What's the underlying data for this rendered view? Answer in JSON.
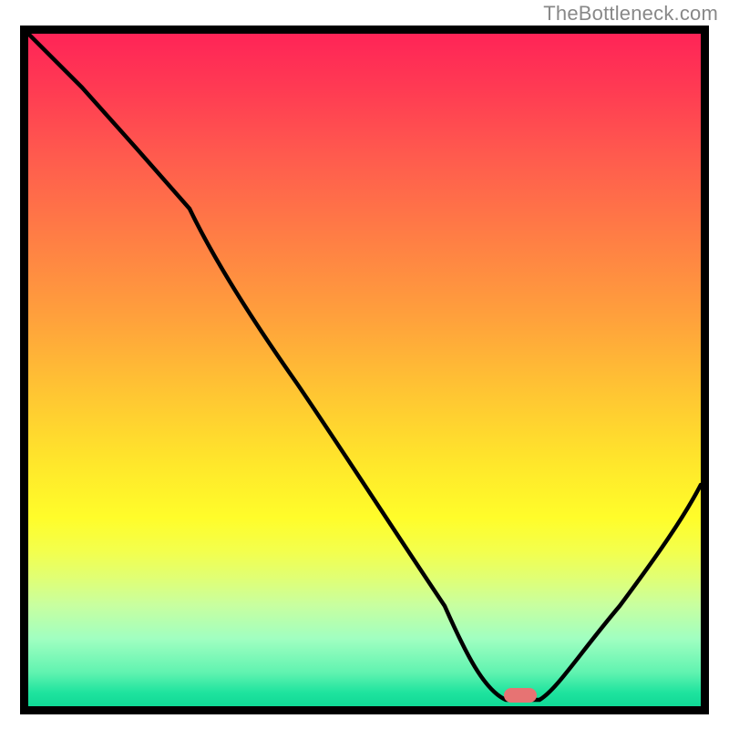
{
  "watermark": "TheBottleneck.com",
  "colors": {
    "frame_border": "#000000",
    "curve": "#000000",
    "marker": "#e77373",
    "gradient_top": "#ff2457",
    "gradient_mid": "#ffe72b",
    "gradient_bottom": "#10d996",
    "watermark_text": "#888888"
  },
  "chart_data": {
    "type": "line",
    "title": "",
    "xlabel": "",
    "ylabel": "",
    "xlim": [
      0,
      100
    ],
    "ylim": [
      0,
      100
    ],
    "annotations": [
      "TheBottleneck.com"
    ],
    "note": "x in 0–100 relative horizontal position, y in 0–100 where 0=bottom 100=top; estimated from image",
    "series": [
      {
        "name": "bottleneck-curve",
        "x": [
          0,
          8,
          16,
          24,
          32,
          40,
          48,
          56,
          62,
          67,
          71,
          76,
          82,
          88,
          94,
          100
        ],
        "y": [
          100,
          92,
          83,
          74,
          65,
          52,
          40,
          27,
          15,
          6,
          1,
          1,
          6,
          14,
          23,
          33
        ]
      }
    ],
    "marker": {
      "x": 73,
      "y": 1,
      "shape": "pill"
    }
  }
}
